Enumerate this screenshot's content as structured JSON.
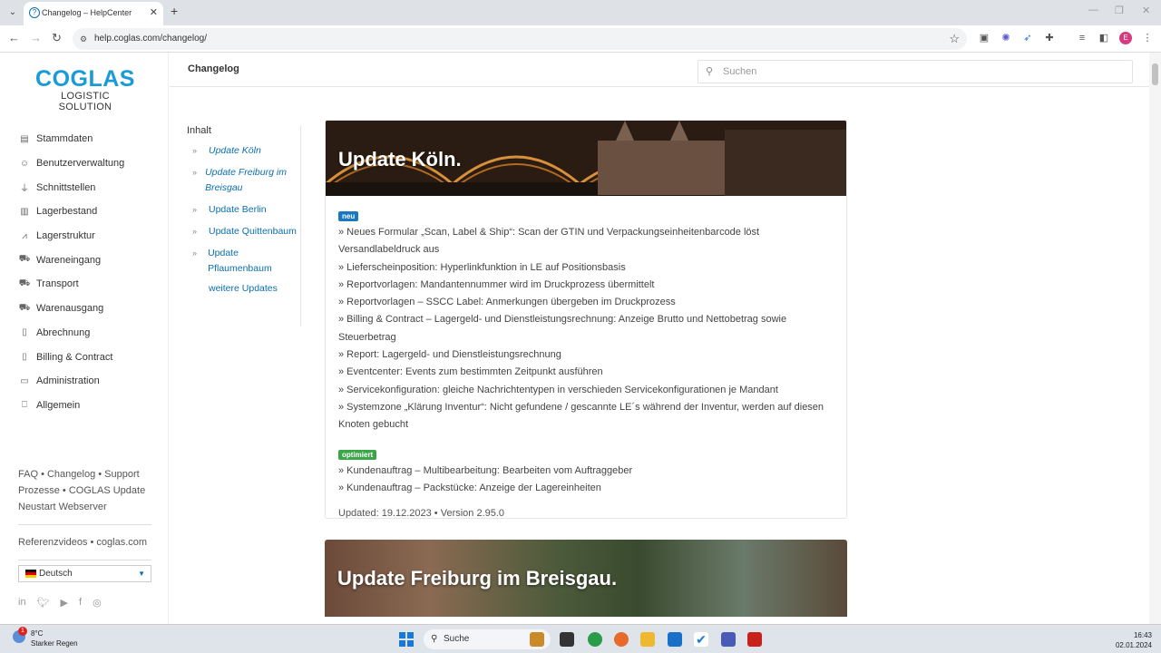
{
  "browser": {
    "tab_title": "Changelog – HelpCenter",
    "url": "help.coglas.com/changelog/"
  },
  "sidebar": {
    "logo_line1": "COGLAS",
    "logo_line2": "LOGISTIC SOLUTION",
    "items": [
      {
        "label": "Stammdaten",
        "icon": "document-icon"
      },
      {
        "label": "Benutzerverwaltung",
        "icon": "users-icon"
      },
      {
        "label": "Schnittstellen",
        "icon": "plug-icon"
      },
      {
        "label": "Lagerbestand",
        "icon": "chart-icon"
      },
      {
        "label": "Lagerstruktur",
        "icon": "chart-line-icon"
      },
      {
        "label": "Wareneingang",
        "icon": "truck-icon"
      },
      {
        "label": "Transport",
        "icon": "truck-icon"
      },
      {
        "label": "Warenausgang",
        "icon": "truck-icon"
      },
      {
        "label": "Abrechnung",
        "icon": "receipt-icon"
      },
      {
        "label": "Billing & Contract",
        "icon": "invoice-icon"
      },
      {
        "label": "Administration",
        "icon": "window-icon"
      },
      {
        "label": "Allgemein",
        "icon": "bookmark-icon"
      }
    ],
    "footer_links": {
      "faq": "FAQ",
      "changelog": "Changelog",
      "support": "Support",
      "prozesse": "Prozesse",
      "coglas_update": "COGLAS Update",
      "neustart": "Neustart Webserver",
      "referenzvideos": "Referenzvideos",
      "coglas_com": "coglas.com"
    },
    "language": "Deutsch"
  },
  "header": {
    "title": "Changelog",
    "search_placeholder": "Suchen"
  },
  "toc": {
    "heading": "Inhalt",
    "items": [
      {
        "label": "Update Köln"
      },
      {
        "label": "Update Freiburg im Breisgau"
      },
      {
        "label": "Update Berlin"
      },
      {
        "label": "Update Quittenbaum"
      },
      {
        "label": "Update Pflaumenbaum"
      }
    ],
    "more": "weitere Updates"
  },
  "update1": {
    "title": "Update Köln.",
    "badge_new": "neu",
    "new_items": [
      "» Neues Formular „Scan, Label & Ship“: Scan der GTIN und Verpackungseinheitenbarcode löst Versandlabeldruck aus",
      "» Lieferscheinposition: Hyperlinkfunktion in LE auf Positionsbasis",
      "» Reportvorlagen: Mandantennummer wird im Druckprozess übermittelt",
      "» Reportvorlagen – SSCC Label: Anmerkungen übergeben im Druckprozess",
      "» Billing & Contract – Lagergeld- und Dienstleistungsrechnung: Anzeige Brutto und Nettobetrag sowie Steuerbetrag",
      "» Report: Lagergeld- und Dienstleistungsrechnung",
      "» Eventcenter: Events zum bestimmten Zeitpunkt ausführen",
      "» Servicekonfiguration: gleiche Nachrichtentypen in verschieden Servicekonfigurationen je Mandant",
      "» Systemzone „Klärung Inventur“: Nicht gefundene / gescannte LE´s während der Inventur, werden auf diesen Knoten gebucht"
    ],
    "badge_opt": "optimiert",
    "opt_items": [
      "» Kundenauftrag – Multibearbeitung: Bearbeiten vom Auftraggeber",
      "» Kundenauftrag – Packstücke: Anzeige der Lagereinheiten"
    ],
    "updated": "Updated: 19.12.2023 • Version 2.95.0"
  },
  "update2": {
    "title": "Update Freiburg im Breisgau."
  },
  "taskbar": {
    "temp": "8°C",
    "weather": "Starker Regen",
    "weather_badge": "1",
    "search": "Suche",
    "time": "16:43",
    "date": "02.01.2024"
  },
  "colors": {
    "brand": "#1a9ad6",
    "link": "#0b6fb0",
    "badge_new": "#1a78c2",
    "badge_opt": "#3aa648"
  }
}
